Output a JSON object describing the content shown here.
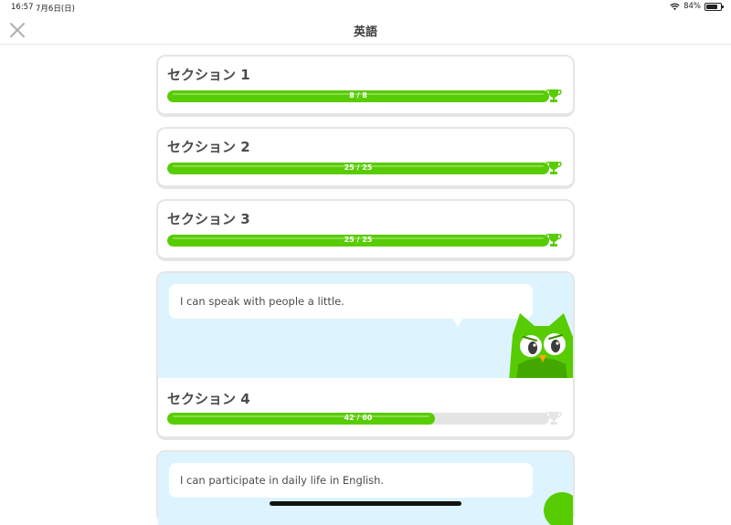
{
  "status": {
    "time": "16:57",
    "date": "7月6日(日)",
    "battery": "84%",
    "battery_level": 0.84
  },
  "nav": {
    "title": "英語"
  },
  "sections": [
    {
      "title": "セクション 1",
      "progress_text": "8 / 8",
      "completed": 8,
      "total": 8
    },
    {
      "title": "セクション 2",
      "progress_text": "25 / 25",
      "completed": 25,
      "total": 25
    },
    {
      "title": "セクション 3",
      "progress_text": "25 / 25",
      "completed": 25,
      "total": 25
    },
    {
      "title": "セクション 4",
      "progress_text": "42 / 60",
      "completed": 42,
      "total": 60,
      "description": "I can speak with people a little."
    },
    {
      "description": "I can participate in daily life in English."
    }
  ],
  "colors": {
    "green": "#58cc02",
    "gray_track": "#e5e5e5",
    "promo_bg": "#ddf4ff",
    "text": "#4b4b4b"
  },
  "icons": {
    "close": "close-icon",
    "trophy": "trophy-icon",
    "wifi": "wifi-icon",
    "mascot": "owl-mascot"
  }
}
